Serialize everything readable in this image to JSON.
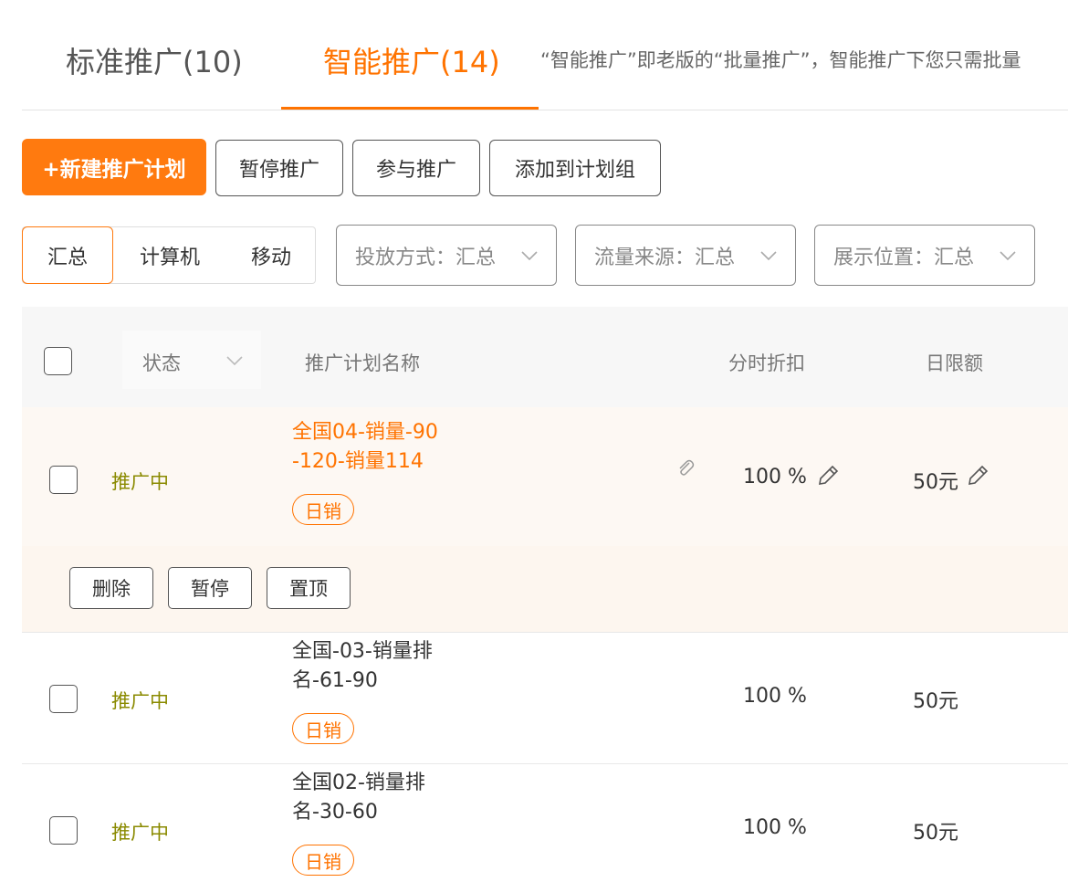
{
  "tabs": {
    "standard": "标准推广(10)",
    "smart": "智能推广(14)",
    "description": "“智能推广”即老版的“批量推广”，智能推广下您只需批量"
  },
  "toolbar": {
    "new_plan": "+新建推广计划",
    "pause": "暂停推广",
    "join": "参与推广",
    "add_group": "添加到计划组"
  },
  "device_segments": [
    "汇总",
    "计算机",
    "移动"
  ],
  "filters": {
    "delivery": "投放方式：汇总",
    "traffic": "流量来源：汇总",
    "placement": "展示位置：汇总"
  },
  "table": {
    "headers": {
      "status": "状态",
      "name": "推广计划名称",
      "discount": "分时折扣",
      "limit": "日限额"
    },
    "rows": [
      {
        "status": "推广中",
        "name_line1": "全国04-销量-90",
        "name_line2": "-120-销量114",
        "tag": "日销",
        "discount": "100 %",
        "limit": "50元"
      },
      {
        "status": "推广中",
        "name_line1": "全国-03-销量排",
        "name_line2": "名-61-90",
        "tag": "日销",
        "discount": "100 %",
        "limit": "50元"
      },
      {
        "status": "推广中",
        "name_line1": "全国02-销量排",
        "name_line2": "名-30-60",
        "tag": "日销",
        "discount": "100 %",
        "limit": "50元"
      }
    ],
    "row_actions": {
      "delete": "删除",
      "pause": "暂停",
      "pin": "置顶"
    }
  },
  "colors": {
    "accent": "#ff7300",
    "status_active": "#8a8a00",
    "hover_row": "#fdf6ef"
  },
  "icons": [
    "chevron-down-icon",
    "pencil-icon",
    "paperclip-icon"
  ]
}
